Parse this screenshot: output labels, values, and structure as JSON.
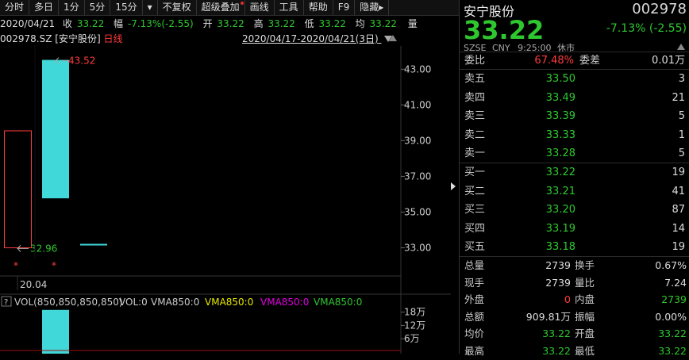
{
  "toolbar": {
    "items": [
      "分时",
      "多日",
      "1分",
      "5分",
      "15分",
      "▾",
      "不复权",
      "超级叠加",
      "画线",
      "工具",
      "帮助",
      "F9",
      "隐藏▸"
    ]
  },
  "quote": {
    "date": "2020/04/21",
    "close_label": "收",
    "close": "33.22",
    "change_label": "幅",
    "change": "-7.13%(-2.55)",
    "open_label": "开",
    "open": "33.22",
    "high_label": "高",
    "high": "33.22",
    "low_label": "低",
    "low": "33.22",
    "avg_label": "均",
    "avg": "33.22",
    "vol_label": "量"
  },
  "chart_header": {
    "code": "002978.SZ",
    "name": "[安宁股份]",
    "period": "日线",
    "range": "2020/04/17-2020/04/21(3日)"
  },
  "chart_data": {
    "type": "candlestick",
    "y_ticks": [
      "43.00",
      "41.00",
      "39.00",
      "37.00",
      "35.00",
      "33.00"
    ],
    "ylim": [
      32.4,
      44.3
    ],
    "candles": [
      {
        "open": 39.55,
        "close": 33.0,
        "high": 39.55,
        "low": 33.0,
        "color": "#ff3b3b",
        "style": "hollow"
      },
      {
        "open": 35.77,
        "close": 43.52,
        "high": 43.52,
        "low": 35.77,
        "color": "#40d8d8",
        "style": "filled"
      },
      {
        "open": 33.22,
        "close": 33.22,
        "high": 33.22,
        "low": 33.22,
        "color": "#40d8d8",
        "style": "filled"
      }
    ],
    "annotations": {
      "max_label": "43.52",
      "min_label": "32.96"
    },
    "x_label": "20.04",
    "volume": {
      "header": [
        "VOL(850,850,850,850)",
        "VOL:0",
        "VMA850:0",
        "VMA850:0",
        "VMA850:0",
        "VMA850:0"
      ],
      "y_ticks": [
        "18万",
        "12万",
        "6万"
      ],
      "ylim": [
        0,
        200000
      ],
      "bars": [
        0,
        190000,
        0
      ]
    }
  },
  "panel": {
    "name": "安宁股份",
    "code": "002978",
    "price": "33.22",
    "change": "-7.13% (-2.55)",
    "exchange": "SZSE",
    "currency": "CNY",
    "time": "9:25:00",
    "status": "休市",
    "wb_label": "委比",
    "wb": "67.48%",
    "wc_label": "委差",
    "wc": "0.01万",
    "asks": [
      {
        "label": "卖五",
        "price": "33.50",
        "vol": "3",
        "color": "#2fc72f"
      },
      {
        "label": "卖四",
        "price": "33.49",
        "vol": "21",
        "color": "#2fc72f"
      },
      {
        "label": "卖三",
        "price": "33.39",
        "vol": "5",
        "color": "#2fc72f"
      },
      {
        "label": "卖二",
        "price": "33.33",
        "vol": "1",
        "color": "#2fc72f"
      },
      {
        "label": "卖一",
        "price": "33.28",
        "vol": "5",
        "color": "#2fc72f"
      }
    ],
    "bids": [
      {
        "label": "买一",
        "price": "33.22",
        "vol": "19",
        "color": "#2fc72f"
      },
      {
        "label": "买二",
        "price": "33.21",
        "vol": "41",
        "color": "#2fc72f"
      },
      {
        "label": "买三",
        "price": "33.20",
        "vol": "87",
        "color": "#2fc72f"
      },
      {
        "label": "买四",
        "price": "33.19",
        "vol": "14",
        "color": "#2fc72f"
      },
      {
        "label": "买五",
        "price": "33.18",
        "vol": "19",
        "color": "#2fc72f"
      }
    ],
    "stats": [
      {
        "l1": "总量",
        "v1": "2739",
        "c1": "#ddd",
        "l2": "换手",
        "v2": "0.67%",
        "c2": "#ddd"
      },
      {
        "l1": "现手",
        "v1": "2739",
        "c1": "#ddd",
        "l2": "量比",
        "v2": "7.24",
        "c2": "#ddd"
      },
      {
        "l1": "外盘",
        "v1": "0",
        "c1": "#ff3b3b",
        "l2": "内盘",
        "v2": "2739",
        "c2": "#2fc72f"
      },
      {
        "l1": "总额",
        "v1": "909.81万",
        "c1": "#ddd",
        "l2": "振幅",
        "v2": "0.00%",
        "c2": "#ddd"
      },
      {
        "l1": "均价",
        "v1": "33.22",
        "c1": "#2fc72f",
        "l2": "开盘",
        "v2": "33.22",
        "c2": "#2fc72f"
      },
      {
        "l1": "最高",
        "v1": "33.22",
        "c1": "#2fc72f",
        "l2": "最低",
        "v2": "33.22",
        "c2": "#2fc72f"
      }
    ]
  }
}
